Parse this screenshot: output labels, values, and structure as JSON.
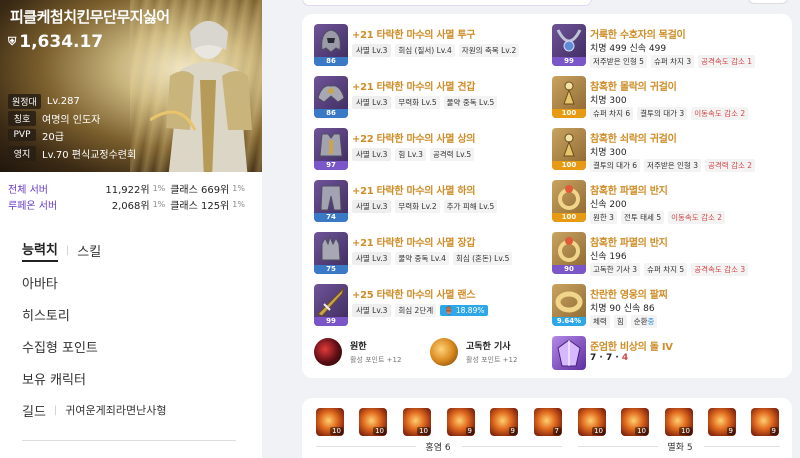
{
  "character": {
    "name": "피클케첩치킨무단무지싫어",
    "item_level": "1,634.17",
    "info": [
      {
        "label": "원정대",
        "value": "Lv.287"
      },
      {
        "label": "칭호",
        "value": "여명의 인도자"
      },
      {
        "label": "PVP",
        "value": "20급"
      },
      {
        "label": "영지",
        "value": "Lv.70 편식교정수련회"
      }
    ],
    "ranks": [
      {
        "server": "전체 서버",
        "rank": "11,922위",
        "rank_pct": "1%",
        "class_rank": "클래스 669위",
        "class_pct": "1%"
      },
      {
        "server": "루페온 서버",
        "rank": "2,068위",
        "rank_pct": "1%",
        "class_rank": "클래스 125위",
        "class_pct": "1%"
      }
    ]
  },
  "menu": {
    "tab_active": "능력치",
    "tab_inactive": "스킬",
    "items": [
      "아바타",
      "히스토리",
      "수집형 포인트",
      "보유 캐릭터"
    ],
    "guild_label": "길드",
    "guild_name": "귀여운게죄라면난사형"
  },
  "armor": [
    {
      "name": "+21 타락한 마수의 사멸 투구",
      "quality": "86",
      "tags": [
        "사멸 Lv.3",
        "회심 (질서) Lv.4",
        "자원의 축복 Lv.2"
      ]
    },
    {
      "name": "+21 타락한 마수의 사멸 견갑",
      "quality": "86",
      "tags": [
        "사멸 Lv.3",
        "무력화 Lv.5",
        "물약 중독 Lv.5"
      ]
    },
    {
      "name": "+22 타락한 마수의 사멸 상의",
      "quality": "97",
      "tags": [
        "사멸 Lv.3",
        "힘 Lv.3",
        "공격력 Lv.5"
      ]
    },
    {
      "name": "+21 타락한 마수의 사멸 하의",
      "quality": "74",
      "tags": [
        "사멸 Lv.3",
        "무력화 Lv.2",
        "추가 피해 Lv.5"
      ]
    },
    {
      "name": "+21 타락한 마수의 사멸 장갑",
      "quality": "75",
      "tags": [
        "사멸 Lv.3",
        "물약 중독 Lv.4",
        "회심 (혼돈) Lv.5"
      ]
    },
    {
      "name": "+25 타락한 마수의 사멸 랜스",
      "quality": "99",
      "tags": [
        "사멸 Lv.3",
        "회심 2단계"
      ],
      "extra": "18.89%"
    }
  ],
  "engravings": [
    {
      "name": "원한",
      "points": "활성 포인트 +12"
    },
    {
      "name": "고독한 기사",
      "points": "활성 포인트 +12"
    }
  ],
  "accessories": [
    {
      "name": "거룩한 수호자의 목걸이",
      "quality": "99",
      "stats": "치명 499  신속 499",
      "tags": [
        "저주받은 인형 5",
        "슈퍼 차지 3",
        "공격속도 감소 1"
      ]
    },
    {
      "name": "참혹한 몰락의 귀걸이",
      "quality": "100",
      "stats": "치명 300",
      "tags": [
        "슈퍼 차지 6",
        "결투의 대가 3",
        "이동속도 감소 2"
      ]
    },
    {
      "name": "참혹한 쇠락의 귀걸이",
      "quality": "100",
      "stats": "치명 300",
      "tags": [
        "결투의 대가 6",
        "저주받은 인형 3",
        "공격력 감소 2"
      ]
    },
    {
      "name": "참혹한 파멸의 반지",
      "quality": "100",
      "stats": "신속 200",
      "tags": [
        "원한 3",
        "전투 태세 5",
        "이동속도 감소 2"
      ]
    },
    {
      "name": "참혹한 파멸의 반지",
      "quality": "90",
      "stats": "신속 196",
      "tags": [
        "고독한 기사 3",
        "슈퍼 차지 5",
        "공격속도 감소 3"
      ]
    },
    {
      "name": "찬란한 영웅의 팔찌",
      "quality": "9.64%",
      "stats": "치명 90  신속 86",
      "tags": [
        "체력",
        "힘",
        "순환"
      ],
      "extra": "중"
    }
  ],
  "stone": {
    "name": "준엄한 비상의 돌 IV",
    "level_a": "7 · 7 · ",
    "level_b": "4"
  },
  "gems": {
    "levels": [
      "10",
      "10",
      "10",
      "9",
      "9",
      "7",
      "10",
      "10",
      "10",
      "9",
      "9"
    ],
    "group_a": "홍염 6",
    "group_b": "멸화 5"
  },
  "colors": {
    "accent": "#cf8d28",
    "purple": "#6a3ecc",
    "quality_orange": "#e79a12",
    "quality_purple": "#7a56c9",
    "quality_blue": "#3a79c6"
  }
}
